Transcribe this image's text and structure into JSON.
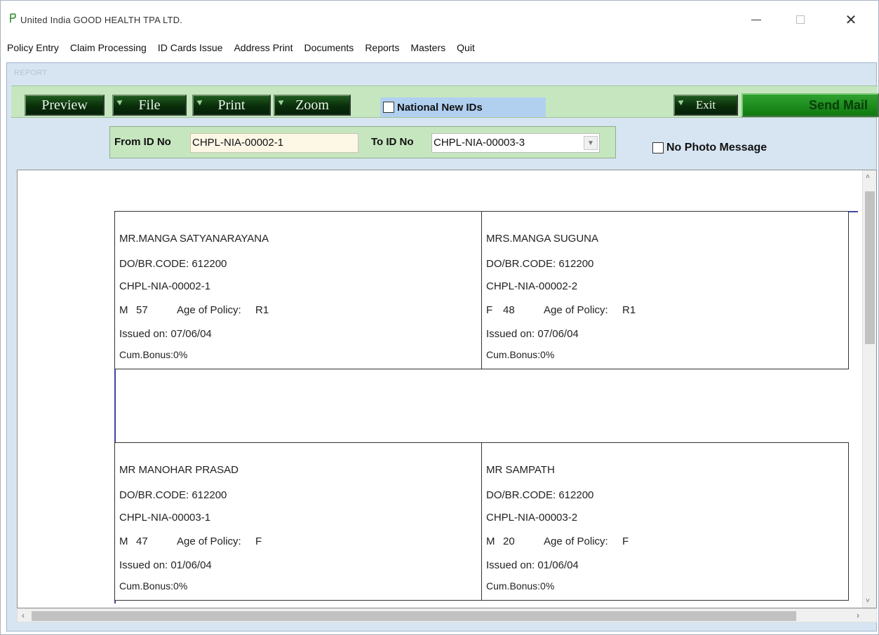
{
  "window": {
    "title": "United India  GOOD HEALTH TPA LTD.",
    "min_icon": "minimize-icon",
    "max_icon": "maximize-icon",
    "close_icon": "close-icon",
    "close_glyph": "✕"
  },
  "menu": [
    "Policy Entry",
    "Claim Processing",
    "ID Cards Issue",
    "Address Print",
    "Documents",
    "Reports",
    "Masters",
    "Quit"
  ],
  "child": {
    "title": "REPORT"
  },
  "toolbar": {
    "preview": "Preview",
    "file": "File",
    "print": "Print",
    "zoom": "Zoom",
    "national_new_ids": "National New IDs",
    "national_checked": false,
    "exit": "Exit",
    "send_mail": "Send Mail"
  },
  "filter": {
    "from_label": "From ID No",
    "from_value": "CHPL-NIA-00002-1",
    "to_label": "To ID No",
    "to_value": "CHPL-NIA-00003-3",
    "no_photo_label": "No Photo Message",
    "no_photo_checked": false
  },
  "cards": [
    {
      "name": "MR.MANGA SATYANARAYANA",
      "code": "DO/BR.CODE: 612200",
      "id": "CHPL-NIA-00002-1",
      "sex": "M",
      "age": "57",
      "aop_label": "Age of Policy:",
      "aop": "R1",
      "issued": "Issued on:  07/06/04",
      "bonus": "Cum.Bonus:0%"
    },
    {
      "name": "MRS.MANGA SUGUNA",
      "code": "DO/BR.CODE: 612200",
      "id": "CHPL-NIA-00002-2",
      "sex": "F",
      "age": "48",
      "aop_label": "Age of Policy:",
      "aop": "R1",
      "issued": "Issued on:  07/06/04",
      "bonus": "Cum.Bonus:0%"
    },
    {
      "name": "MR MANOHAR PRASAD",
      "code": "DO/BR.CODE: 612200",
      "id": "CHPL-NIA-00003-1",
      "sex": "M",
      "age": "47",
      "aop_label": "Age of Policy:",
      "aop": "F",
      "issued": "Issued on:  01/06/04",
      "bonus": "Cum.Bonus:0%"
    },
    {
      "name": "MR SAMPATH",
      "code": "DO/BR.CODE: 612200",
      "id": "CHPL-NIA-00003-2",
      "sex": "M",
      "age": "20",
      "aop_label": "Age of Policy:",
      "aop": "F",
      "issued": "Issued on:  01/06/04",
      "bonus": "Cum.Bonus:0%"
    }
  ],
  "scroll": {
    "up": "˄",
    "down": "˅",
    "left": "‹",
    "right": "›"
  },
  "colors": {
    "toolbar_bg": "#c6e6bf",
    "child_bg": "#d7e4f2",
    "button_dark": "#0a2e0a",
    "send_mail_green": "#1f8f1f"
  }
}
